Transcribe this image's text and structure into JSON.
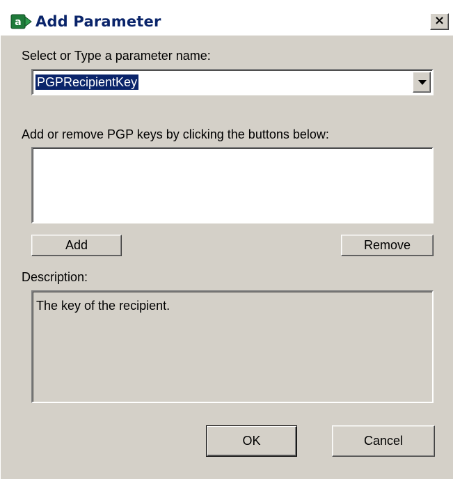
{
  "window": {
    "title": "Add Parameter",
    "icon_letter": "a",
    "close_glyph": "×"
  },
  "parameter": {
    "label": "Select or Type a parameter name:",
    "value": "PGPRecipientKey"
  },
  "keys": {
    "label": "Add or remove PGP keys by clicking the buttons below:",
    "items": [],
    "add_label": "Add",
    "remove_label": "Remove"
  },
  "description": {
    "label": "Description:",
    "text": "The key of the recipient."
  },
  "footer": {
    "ok_label": "OK",
    "cancel_label": "Cancel"
  },
  "colors": {
    "face": "#d4d0c8",
    "title_text": "#0a246a",
    "selection": "#0a246a",
    "icon_green": "#1f7a3a"
  }
}
